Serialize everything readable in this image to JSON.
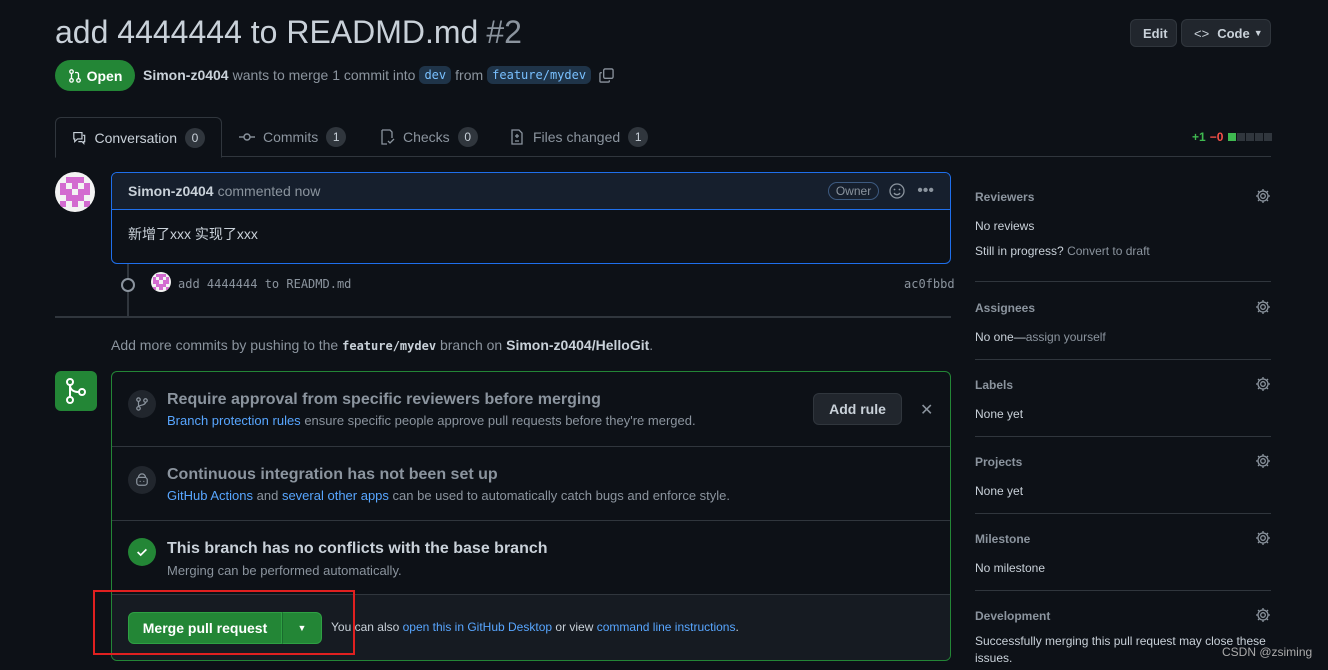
{
  "header": {
    "title": "add 4444444 to READMD.md",
    "number": "#2",
    "edit_label": "Edit",
    "code_label": "Code"
  },
  "status": {
    "badge": "Open",
    "author": "Simon-z0404",
    "action": "wants to merge 1 commit into",
    "base_branch": "dev",
    "from_word": "from",
    "head_branch": "feature/mydev"
  },
  "tabs": [
    {
      "label": "Conversation",
      "count": "0"
    },
    {
      "label": "Commits",
      "count": "1"
    },
    {
      "label": "Checks",
      "count": "0"
    },
    {
      "label": "Files changed",
      "count": "1"
    }
  ],
  "diffstat": {
    "additions": "+1",
    "deletions": "−0"
  },
  "comment": {
    "author": "Simon-z0404",
    "time": "commented now",
    "role": "Owner",
    "body": "新增了xxx 实现了xxx"
  },
  "commit": {
    "message": "add 4444444 to READMD.md",
    "sha": "ac0fbbd"
  },
  "push_hint": {
    "prefix": "Add more commits by pushing to the",
    "branch": "feature/mydev",
    "middle": "branch on",
    "repo": "Simon-z0404/HelloGit",
    "suffix": "."
  },
  "merge_box": {
    "rule_title": "Require approval from specific reviewers before merging",
    "rule_link": "Branch protection rules",
    "rule_text": "ensure specific people approve pull requests before they're merged.",
    "add_rule_label": "Add rule",
    "ci_title": "Continuous integration has not been set up",
    "ci_link1": "GitHub Actions",
    "ci_and": "and",
    "ci_link2": "several other apps",
    "ci_text": "can be used to automatically catch bugs and enforce style.",
    "conflict_title": "This branch has no conflicts with the base branch",
    "conflict_text": "Merging can be performed automatically.",
    "merge_label": "Merge pull request",
    "alt_prefix": "You can also",
    "alt_link1": "open this in GitHub Desktop",
    "alt_mid": "or view",
    "alt_link2": "command line instructions",
    "alt_suffix": "."
  },
  "sidebar": {
    "reviewers": {
      "title": "Reviewers",
      "value": "No reviews",
      "progress_q": "Still in progress?",
      "progress_link": "Convert to draft"
    },
    "assignees": {
      "title": "Assignees",
      "value_prefix": "No one—",
      "value_link": "assign yourself"
    },
    "labels": {
      "title": "Labels",
      "value": "None yet"
    },
    "projects": {
      "title": "Projects",
      "value": "None yet"
    },
    "milestone": {
      "title": "Milestone",
      "value": "No milestone"
    },
    "development": {
      "title": "Development",
      "value": "Successfully merging this pull request may close these issues."
    }
  },
  "watermark": "CSDN @zsiming"
}
